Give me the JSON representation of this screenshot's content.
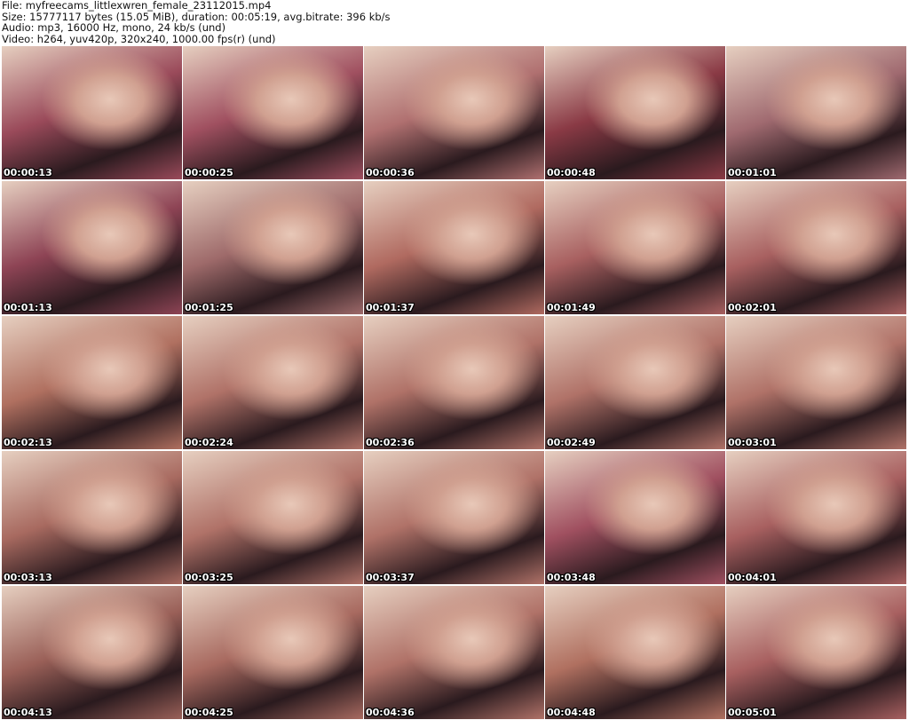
{
  "header": {
    "file": "File: myfreecams_littlexwren_female_23112015.mp4",
    "size": "Size: 15777117 bytes (15.05 MiB), duration: 00:05:19, avg.bitrate: 396 kb/s",
    "audio": "Audio: mp3, 16000 Hz, mono, 24 kb/s (und)",
    "video": "Video: h264, yuv420p, 320x240, 1000.00 fps(r) (und)"
  },
  "thumbnails": [
    {
      "time": "00:00:13",
      "color": "#9a4a5a"
    },
    {
      "time": "00:00:25",
      "color": "#a05060"
    },
    {
      "time": "00:00:36",
      "color": "#b07070"
    },
    {
      "time": "00:00:48",
      "color": "#8a3a45"
    },
    {
      "time": "00:01:01",
      "color": "#a06a70"
    },
    {
      "time": "00:01:13",
      "color": "#8e4455"
    },
    {
      "time": "00:01:25",
      "color": "#9e6a6a"
    },
    {
      "time": "00:01:37",
      "color": "#b06a60"
    },
    {
      "time": "00:01:49",
      "color": "#a86060"
    },
    {
      "time": "00:02:01",
      "color": "#a86060"
    },
    {
      "time": "00:02:13",
      "color": "#b07060"
    },
    {
      "time": "00:02:24",
      "color": "#b07268"
    },
    {
      "time": "00:02:36",
      "color": "#b07268"
    },
    {
      "time": "00:02:49",
      "color": "#b07268"
    },
    {
      "time": "00:03:01",
      "color": "#b07268"
    },
    {
      "time": "00:03:13",
      "color": "#a86a60"
    },
    {
      "time": "00:03:25",
      "color": "#b07268"
    },
    {
      "time": "00:03:37",
      "color": "#b07268"
    },
    {
      "time": "00:03:48",
      "color": "#a05060"
    },
    {
      "time": "00:04:01",
      "color": "#a86060"
    },
    {
      "time": "00:04:13",
      "color": "#9a6058"
    },
    {
      "time": "00:04:25",
      "color": "#a86a60"
    },
    {
      "time": "00:04:36",
      "color": "#b07268"
    },
    {
      "time": "00:04:48",
      "color": "#b07060"
    },
    {
      "time": "00:05:01",
      "color": "#a86060"
    }
  ]
}
